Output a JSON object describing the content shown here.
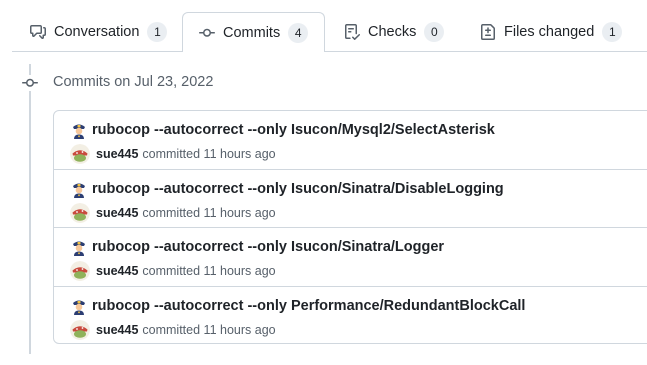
{
  "tabs": [
    {
      "label": "Conversation",
      "count": "1",
      "icon": "comment-discussion-icon",
      "active": false
    },
    {
      "label": "Commits",
      "count": "4",
      "icon": "git-commit-icon",
      "active": true
    },
    {
      "label": "Checks",
      "count": "0",
      "icon": "checklist-icon",
      "active": false
    },
    {
      "label": "Files changed",
      "count": "1",
      "icon": "file-diff-icon",
      "active": false
    }
  ],
  "timeline": {
    "heading": "Commits on Jul 23, 2022"
  },
  "commits": [
    {
      "title": "rubocop --autocorrect --only Isucon/Mysql2/SelectAsterisk",
      "author": "sue445",
      "action": "committed",
      "time": "11 hours ago"
    },
    {
      "title": "rubocop --autocorrect --only Isucon/Sinatra/DisableLogging",
      "author": "sue445",
      "action": "committed",
      "time": "11 hours ago"
    },
    {
      "title": "rubocop --autocorrect --only Isucon/Sinatra/Logger",
      "author": "sue445",
      "action": "committed",
      "time": "11 hours ago"
    },
    {
      "title": "rubocop --autocorrect --only Performance/RedundantBlockCall",
      "author": "sue445",
      "action": "committed",
      "time": "11 hours ago"
    }
  ],
  "colors": {
    "border": "#d0d7de",
    "muted_text": "#57606a",
    "counter_bg": "#eaeef2"
  }
}
